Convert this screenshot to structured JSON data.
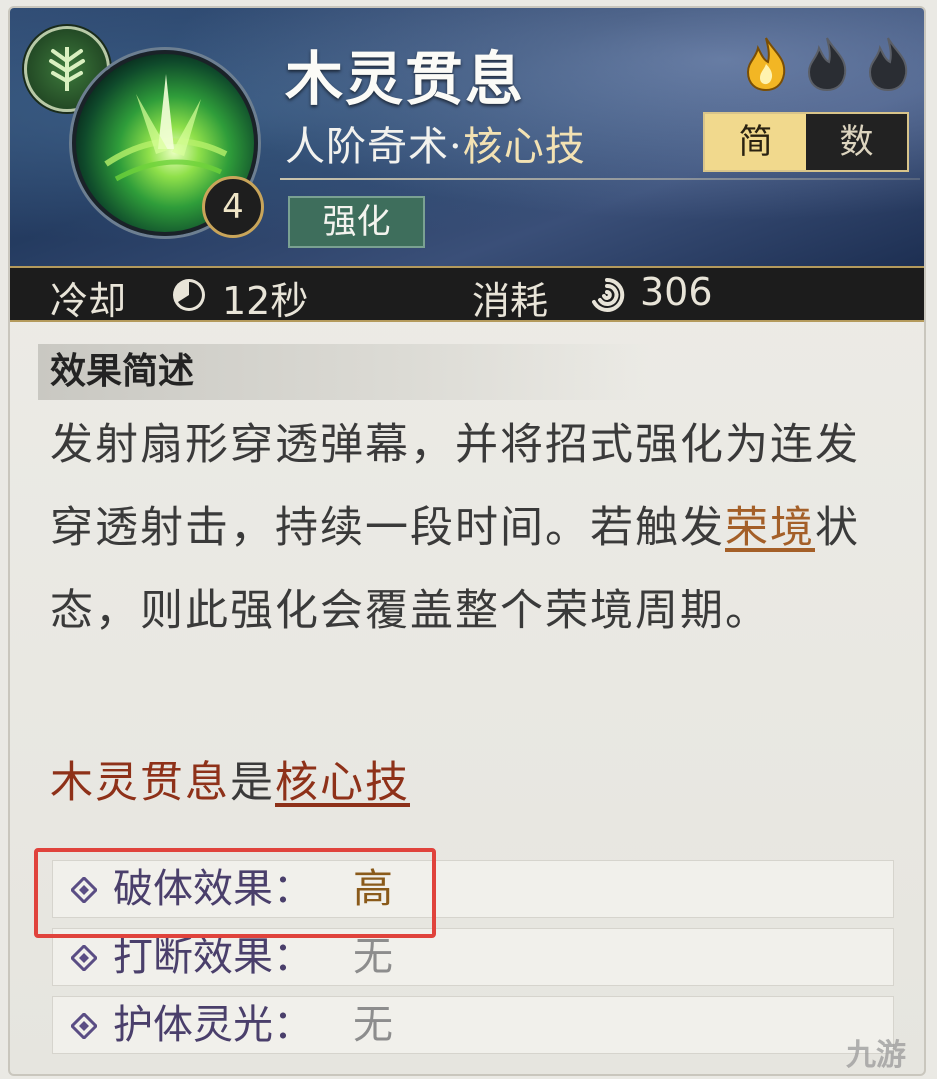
{
  "skill": {
    "name": "木灵贯息",
    "type_prefix": "人阶奇术·",
    "type_core": "核心技",
    "level": "4",
    "tag": "强化",
    "flames_lit": 1,
    "flames_total": 3
  },
  "view_toggle": {
    "simple": "简",
    "numeric": "数",
    "selected": "简"
  },
  "stats": {
    "cooldown_label": "冷却",
    "cooldown_value": "12秒",
    "cost_label": "消耗",
    "cost_value": "306"
  },
  "summary": {
    "title": "效果简述",
    "text_1": "发射扇形穿透弹幕，并将招式强化为连发穿透射击，持续一段时间。若触发",
    "keyword": "荣境",
    "text_2": "状态，则此强化会覆盖整个荣境周期。",
    "core_name": "木灵贯息",
    "core_is": "是",
    "core_link": "核心技"
  },
  "attributes": [
    {
      "label": "破体效果：",
      "value": "高"
    },
    {
      "label": "打断效果：",
      "value": "无"
    },
    {
      "label": "护体灵光：",
      "value": "无"
    }
  ],
  "watermark": "九游",
  "colors": {
    "header_bg": "#2f4a72",
    "tag_bg": "#3e6e5c",
    "toggle_active": "#f1d98d",
    "keyword": "#a45f28",
    "core_name": "#8e3119",
    "attr_label": "#4a3f6b",
    "highlight_border": "#e0433c"
  }
}
